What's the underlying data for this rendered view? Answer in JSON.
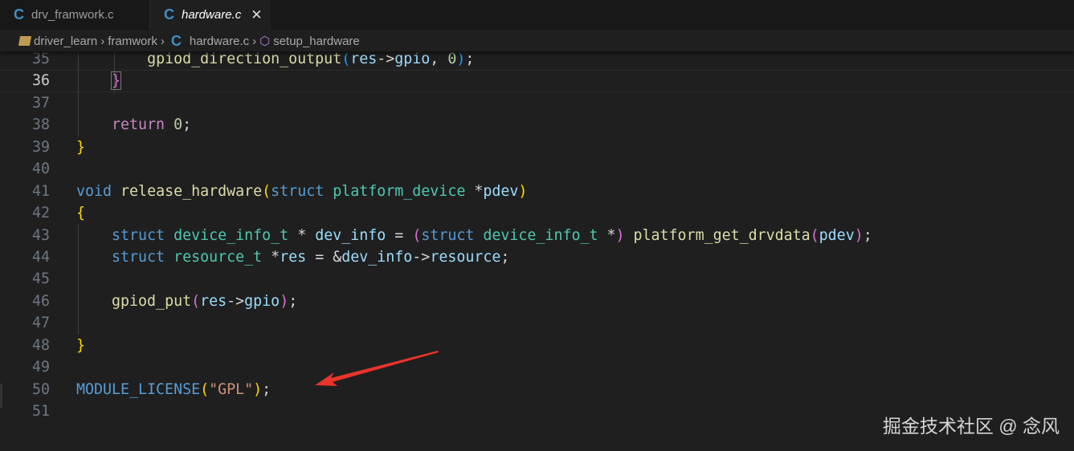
{
  "tabs": [
    {
      "label": "drv_framwork.c",
      "icon": "c-file-icon",
      "active": false
    },
    {
      "label": "hardware.c",
      "icon": "c-file-icon",
      "active": true
    }
  ],
  "breadcrumb": [
    "driver_learn",
    "framwork",
    "hardware.c",
    "setup_hardware"
  ],
  "current_line": 36,
  "lines": [
    {
      "n": "35",
      "tokens": [
        [
          "        ",
          ""
        ],
        [
          "gpiod_direction_output",
          "f"
        ],
        [
          "(",
          "b3"
        ],
        [
          "res",
          "v"
        ],
        [
          "->",
          "p"
        ],
        [
          "gpio",
          "v"
        ],
        [
          ", ",
          "p"
        ],
        [
          "0",
          "n"
        ],
        [
          ")",
          "b3"
        ],
        [
          ";",
          "p"
        ]
      ]
    },
    {
      "n": "36",
      "tokens": [
        [
          "    ",
          ""
        ],
        [
          "}",
          "b2 box"
        ]
      ]
    },
    {
      "n": "37",
      "tokens": []
    },
    {
      "n": "38",
      "tokens": [
        [
          "    ",
          ""
        ],
        [
          "return",
          "r"
        ],
        [
          " ",
          ""
        ],
        [
          "0",
          "n"
        ],
        [
          ";",
          "p"
        ]
      ]
    },
    {
      "n": "39",
      "tokens": [
        [
          "}",
          "b1"
        ]
      ]
    },
    {
      "n": "40",
      "tokens": []
    },
    {
      "n": "41",
      "tokens": [
        [
          "void",
          "k"
        ],
        [
          " ",
          ""
        ],
        [
          "release_hardware",
          "f"
        ],
        [
          "(",
          "b1"
        ],
        [
          "struct",
          "k"
        ],
        [
          " ",
          ""
        ],
        [
          "platform_device",
          "t"
        ],
        [
          " *",
          "p"
        ],
        [
          "pdev",
          "v"
        ],
        [
          ")",
          "b1"
        ]
      ]
    },
    {
      "n": "42",
      "tokens": [
        [
          "{",
          "b1"
        ]
      ]
    },
    {
      "n": "43",
      "tokens": [
        [
          "    ",
          ""
        ],
        [
          "struct",
          "k"
        ],
        [
          " ",
          ""
        ],
        [
          "device_info_t",
          "t"
        ],
        [
          " * ",
          "p"
        ],
        [
          "dev_info",
          "v"
        ],
        [
          " = ",
          "p"
        ],
        [
          "(",
          "b2"
        ],
        [
          "struct",
          "k"
        ],
        [
          " ",
          ""
        ],
        [
          "device_info_t",
          "t"
        ],
        [
          " *",
          "p"
        ],
        [
          ")",
          "b2"
        ],
        [
          " ",
          ""
        ],
        [
          "platform_get_drvdata",
          "f"
        ],
        [
          "(",
          "b2"
        ],
        [
          "pdev",
          "v"
        ],
        [
          ")",
          "b2"
        ],
        [
          ";",
          "p"
        ]
      ]
    },
    {
      "n": "44",
      "tokens": [
        [
          "    ",
          ""
        ],
        [
          "struct",
          "k"
        ],
        [
          " ",
          ""
        ],
        [
          "resource_t",
          "t"
        ],
        [
          " *",
          "p"
        ],
        [
          "res",
          "v"
        ],
        [
          " = &",
          "p"
        ],
        [
          "dev_info",
          "v"
        ],
        [
          "->",
          "p"
        ],
        [
          "resource",
          "v"
        ],
        [
          ";",
          "p"
        ]
      ]
    },
    {
      "n": "45",
      "tokens": []
    },
    {
      "n": "46",
      "tokens": [
        [
          "    ",
          ""
        ],
        [
          "gpiod_put",
          "f"
        ],
        [
          "(",
          "b2"
        ],
        [
          "res",
          "v"
        ],
        [
          "->",
          "p"
        ],
        [
          "gpio",
          "v"
        ],
        [
          ")",
          "b2"
        ],
        [
          ";",
          "p"
        ]
      ]
    },
    {
      "n": "47",
      "tokens": []
    },
    {
      "n": "48",
      "tokens": [
        [
          "}",
          "b1"
        ]
      ]
    },
    {
      "n": "49",
      "tokens": []
    },
    {
      "n": "50",
      "tokens": [
        [
          "MODULE_LICENSE",
          "m"
        ],
        [
          "(",
          "b1"
        ],
        [
          "\"GPL\"",
          "s"
        ],
        [
          ")",
          "b1"
        ],
        [
          ";",
          "p"
        ]
      ]
    },
    {
      "n": "51",
      "tokens": []
    }
  ],
  "watermark": "掘金技术社区 @ 念风",
  "annotation": {
    "type": "red-arrow",
    "color": "#e8342b",
    "points_to_line": 50
  }
}
